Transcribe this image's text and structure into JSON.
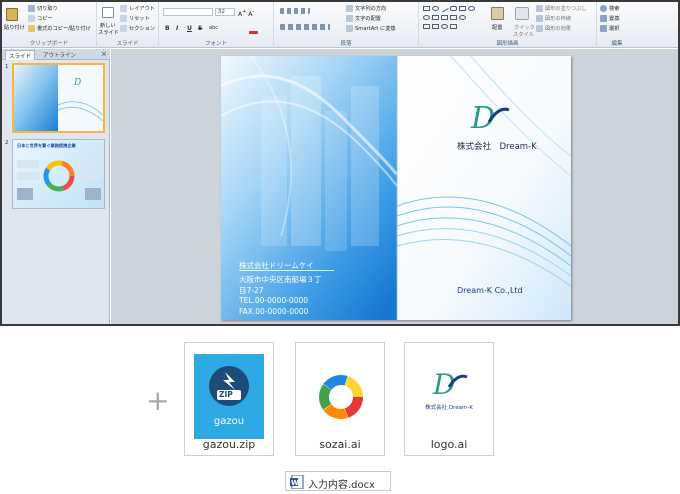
{
  "ribbon": {
    "clipboard": {
      "paste": "貼り付け",
      "cut": "切り取り",
      "copy": "コピー",
      "format_painter": "書式のコピー/貼り付け",
      "title": "クリップボード"
    },
    "slides": {
      "new_slide": "新しい",
      "new_slide2": "スライド",
      "layout": "レイアウト",
      "reset": "リセット",
      "section": "セクション",
      "title": "スライド"
    },
    "font": {
      "size": "32",
      "bold": "B",
      "italic": "I",
      "underline": "U",
      "strike": "S",
      "shadow": "abc",
      "title": "フォント"
    },
    "paragraph": {
      "text_direction": "文字列の方向",
      "align_text": "文字の配置",
      "smartart": "SmartArt に変換",
      "title": "段落"
    },
    "drawing": {
      "arrange": "配置",
      "quick_styles": "クイック",
      "quick_styles2": "スタイル",
      "shape_fill": "図形の塗りつぶし",
      "shape_outline": "図形の枠線",
      "shape_effects": "図形の効果",
      "title": "図形描画"
    },
    "editing": {
      "find": "検索",
      "replace": "置換",
      "select": "選択",
      "title": "編集"
    }
  },
  "pane": {
    "tab_slides": "スライド",
    "tab_outline": "アウトライン",
    "close": "×",
    "slide1_number": "1",
    "slide2_number": "2",
    "slide2_heading": "日本と世界を繋ぐ業務提携企業"
  },
  "slide": {
    "company_jp": "株式会社　Dream-K",
    "company_en": "Dream-K Co.,Ltd",
    "address_lines": [
      "株式会社ドリームケイ",
      "大阪市中央区南船場３丁",
      "目7-27",
      "TEL.00-0000-0000",
      "FAX.00-0000-0000"
    ],
    "logo_text": "Dc"
  },
  "attachments": {
    "plus": "+",
    "files": [
      {
        "name": "gazou.zip",
        "icon_label": "ZIP",
        "caption": "gazou",
        "icon": "zip-archive-icon"
      },
      {
        "name": "sozai.ai",
        "icon": "color-ring-icon"
      },
      {
        "name": "logo.ai",
        "icon": "dream-k-logo-icon",
        "logo_caption": "株式会社 Dream-K"
      }
    ],
    "doc": {
      "name": "入力内容.docx",
      "icon": "word-document-icon"
    }
  },
  "colors": {
    "accent": "#1a7fd4",
    "ribbon_bg": "#e6ebf2",
    "selected_border": "#f5b83d",
    "logo_teal": "#2a9a8a",
    "logo_navy": "#1b3f7a"
  }
}
